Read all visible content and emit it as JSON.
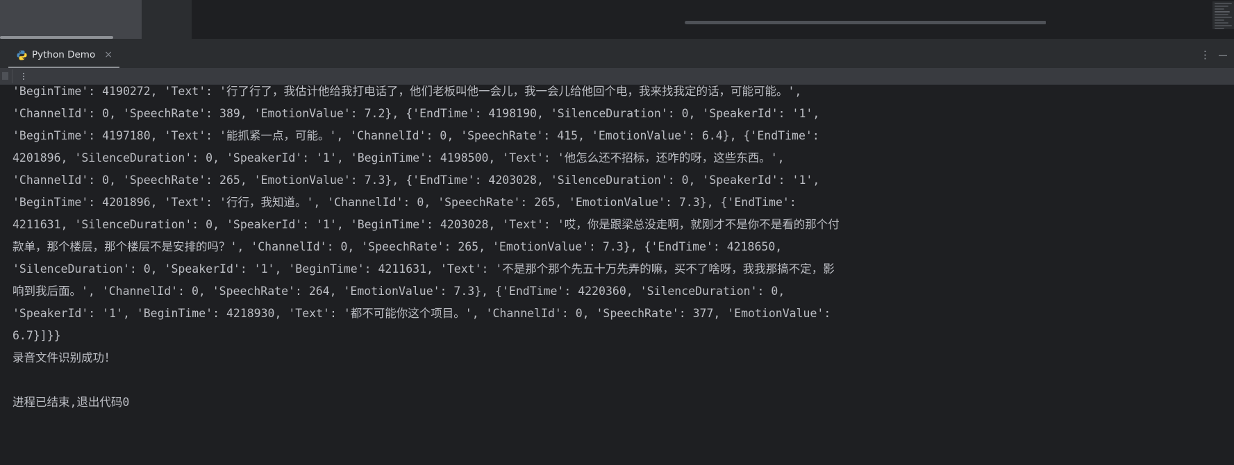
{
  "window": {
    "minimize_label": "—",
    "options_label": "⋮"
  },
  "tab": {
    "label": "Python Demo",
    "close_label": "×",
    "icon": "python-logo-icon"
  },
  "console_toolbar": {
    "menu_label": "⋮"
  },
  "console": {
    "lines": [
      "'BeginTime': 4190272, 'Text': '行了行了，我估计他给我打电话了，他们老板叫他一会儿，我一会儿给他回个电，我来找我定的话，可能可能。',",
      "'ChannelId': 0, 'SpeechRate': 389, 'EmotionValue': 7.2}, {'EndTime': 4198190, 'SilenceDuration': 0, 'SpeakerId': '1',",
      "'BeginTime': 4197180, 'Text': '能抓紧一点，可能。', 'ChannelId': 0, 'SpeechRate': 415, 'EmotionValue': 6.4}, {'EndTime':",
      "4201896, 'SilenceDuration': 0, 'SpeakerId': '1', 'BeginTime': 4198500, 'Text': '他怎么还不招标，还咋的呀，这些东西。',",
      "'ChannelId': 0, 'SpeechRate': 265, 'EmotionValue': 7.3}, {'EndTime': 4203028, 'SilenceDuration': 0, 'SpeakerId': '1',",
      "'BeginTime': 4201896, 'Text': '行行，我知道。', 'ChannelId': 0, 'SpeechRate': 265, 'EmotionValue': 7.3}, {'EndTime':",
      "4211631, 'SilenceDuration': 0, 'SpeakerId': '1', 'BeginTime': 4203028, 'Text': '哎，你是跟梁总没走啊，就刚才不是你不是看的那个付",
      "款单，那个楼层，那个楼层不是安排的吗？', 'ChannelId': 0, 'SpeechRate': 265, 'EmotionValue': 7.3}, {'EndTime': 4218650,",
      "'SilenceDuration': 0, 'SpeakerId': '1', 'BeginTime': 4211631, 'Text': '不是那个那个先五十万先弄的嘛，买不了啥呀，我我那搞不定，影",
      "响到我后面。', 'ChannelId': 0, 'SpeechRate': 264, 'EmotionValue': 7.3}, {'EndTime': 4220360, 'SilenceDuration': 0,",
      "'SpeakerId': '1', 'BeginTime': 4218930, 'Text': '都不可能你这个项目。', 'ChannelId': 0, 'SpeechRate': 377, 'EmotionValue':",
      "6.7}]}}"
    ],
    "success_message": "录音文件识别成功！",
    "exit_message": "进程已结束,退出代码0"
  },
  "colors": {
    "console_bg": "#1e1f22",
    "chrome_bg": "#2b2d30",
    "toolbar_bg": "#393b40",
    "text": "#bcbec4",
    "tab_underline": "#8e9196"
  }
}
